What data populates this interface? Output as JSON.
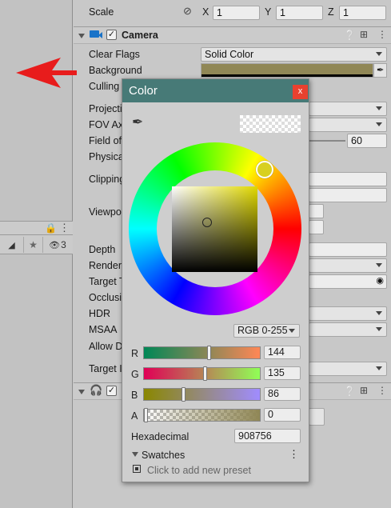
{
  "hierarchy": {
    "visibility_count": "3"
  },
  "transform": {
    "scale_label": "Scale",
    "x_label": "X",
    "x_value": "1",
    "y_label": "Y",
    "y_value": "1",
    "z_label": "Z",
    "z_value": "1"
  },
  "camera": {
    "title": "Camera",
    "enabled": true,
    "rows": {
      "clear_flags": "Clear Flags",
      "background": "Background",
      "culling": "Culling",
      "projection": "Projectio",
      "fov_axis": "FOV Ax",
      "field_of_view": "Field of",
      "physical": "Physica",
      "clipping": "Clipping",
      "viewport": "Viewpo",
      "depth": "Depth",
      "rendering": "Renderi",
      "target_texture": "Target T",
      "occlusion": "Occlusi",
      "hdr": "HDR",
      "msaa": "MSAA",
      "allow_dynamic": "Allow D",
      "target_display": "Target I"
    },
    "clear_flags_value": "Solid Color",
    "background_color": "#908756",
    "fov_value": "60"
  },
  "color_picker": {
    "title": "Color",
    "close_label": "x",
    "mode": "RGB 0-255",
    "channels": [
      {
        "label": "R",
        "value": "144",
        "fraction": 0.565
      },
      {
        "label": "G",
        "value": "135",
        "fraction": 0.529
      },
      {
        "label": "B",
        "value": "86",
        "fraction": 0.337
      },
      {
        "label": "A",
        "value": "0",
        "fraction": 0.0
      }
    ],
    "hex_label": "Hexadecimal",
    "hex_value": "908756",
    "swatches_label": "Swatches",
    "swatches_hint": "Click to add new preset"
  },
  "colors": {
    "title_bar": "#477a77",
    "close_button": "#e8412f",
    "hue_handle": "#d8d020"
  }
}
